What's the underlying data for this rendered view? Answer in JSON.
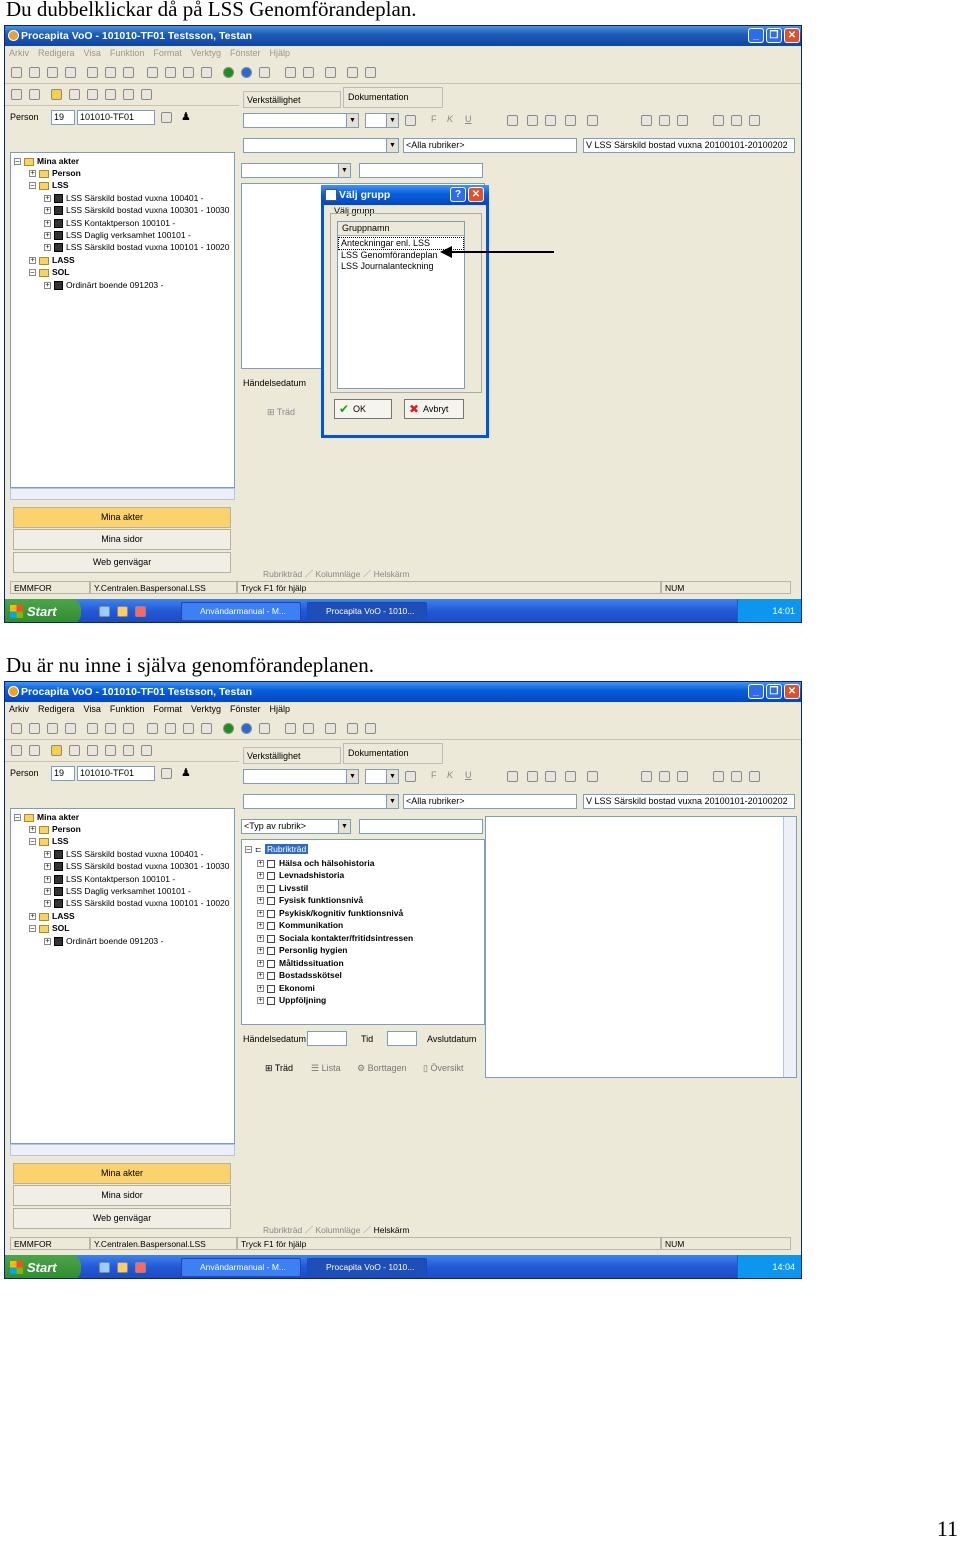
{
  "captions": {
    "first": "Du dubbelklickar då på LSS Genomförandeplan.",
    "second": "Du är nu inne i själva genomförandeplanen."
  },
  "page_number": "11",
  "app": {
    "title": "Procapita VoO - 101010-TF01 Testsson, Testan",
    "menu": [
      "Arkiv",
      "Redigera",
      "Visa",
      "Funktion",
      "Format",
      "Verktyg",
      "Fönster",
      "Hjälp"
    ],
    "window_buttons": [
      "_",
      "❐",
      "✕"
    ],
    "person_label": "Person",
    "person_num": "19",
    "person_id": "101010-TF01",
    "tabs": [
      "Verkställighet",
      "Dokumentation"
    ],
    "all_rubrics": "<Alla rubriker>",
    "decision": "V LSS Särskild bostad vuxna 20100101-20100202",
    "tree": {
      "root": "Mina akter",
      "person": "Person",
      "lss": "LSS",
      "lss_items": [
        "LSS Särskild bostad vuxna 100401 -",
        "LSS Särskild bostad vuxna 100301 - 10030",
        "LSS Kontaktperson 100101 -",
        "LSS Daglig verksamhet 100101 -",
        "LSS Särskild bostad vuxna 100101 - 10020"
      ],
      "lass": "LASS",
      "sol": "SOL",
      "sol_items": [
        "Ordinärt boende 091203 -"
      ]
    },
    "nav": [
      "Mina akter",
      "Mina sidor",
      "Web genvägar"
    ],
    "bottom_tabs": [
      "Rubrikträd",
      "Kolumnläge",
      "Helskärm"
    ],
    "status": [
      "EMMFOR",
      "Y.Centralen.Baspersonal.LSS",
      "Tryck F1 för hjälp",
      "NUM"
    ],
    "taskbar": {
      "start": "Start",
      "buttons": [
        "Användarmanual - M...",
        "Procapita VoO - 1010..."
      ],
      "time1": "14:01",
      "time2": "14:04"
    }
  },
  "screen1": {
    "event_date": "Händelsedatum",
    "tree_btn": "Träd",
    "dialog": {
      "title": "Välj grupp",
      "help": "?",
      "close": "✕",
      "groupbox": "Välj grupp",
      "column": "Gruppnamn",
      "items": [
        "Anteckningar enl. LSS",
        "LSS Genomförandeplan",
        "LSS Journalanteckning"
      ],
      "ok": "OK",
      "cancel": "Avbryt"
    }
  },
  "screen2": {
    "type_rubric": "<Typ av rubrik>",
    "root": "Rubrikträd",
    "rubrics": [
      "Hälsa och hälsohistoria",
      "Levnadshistoria",
      "Livsstil",
      "Fysisk funktionsnivå",
      "Psykisk/kognitiv funktionsnivå",
      "Kommunikation",
      "Sociala kontakter/fritidsintressen",
      "Personlig hygien",
      "Måltidssituation",
      "Bostadsskötsel",
      "Ekonomi",
      "Uppföljning"
    ],
    "event_date": "Händelsedatum",
    "time": "Tid",
    "end_date": "Avslutdatum",
    "view_buttons": [
      "Träd",
      "Lista",
      "Borttagen",
      "Översikt"
    ]
  }
}
